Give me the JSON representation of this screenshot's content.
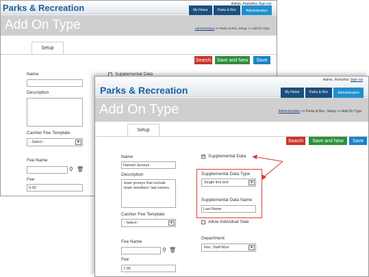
{
  "app": {
    "brand": "Parks & Recreation",
    "page_title": "Add On Type"
  },
  "topright": {
    "user": "Admin, ParksRec",
    "signout": "Sign out"
  },
  "nav": {
    "my_home": "My Home",
    "parks_rec": "Parks & Rec",
    "administration": "Administration"
  },
  "breadcrumb": {
    "admin": "Administration",
    "rest": ">> Parks & Rec. Setup >> Add On Type"
  },
  "tab": {
    "setup": "Setup"
  },
  "buttons": {
    "search": "Search",
    "save_and_new": "Save and New",
    "save": "Save"
  },
  "form": {
    "name_label": "Name",
    "name_value": "Named Jerseys",
    "description_label": "Description",
    "description_value": "team jerseys that include team members' last names.",
    "cashier_fee_template_label": "Cashier Fee Template",
    "cashier_fee_template_value": "- Select -",
    "fee_name_label": "Fee Name",
    "fee_label": "Fee",
    "fee_value_back": "0.00",
    "fee_value_front": "7.00",
    "supplemental_data_label": "Supplemental Data",
    "supplemental_data_type_label": "Supplemental Data Type",
    "supplemental_data_type_value": "Single line text",
    "supplemental_data_name_label": "Supplemental Data Name",
    "supplemental_data_name_value": "Last Name",
    "allow_individual_sale_label": "Allow Individual Sale",
    "department_label": "Department",
    "department_value": "Rec: Staff-Mun"
  },
  "icons": {
    "search": "magnifier-icon",
    "delete": "trash-icon",
    "dropdown": "chevron-down-icon",
    "check": "checkmark-icon"
  },
  "colors": {
    "brand": "#1d5f99",
    "nav": "#1b4f7d",
    "nav_active": "#1f8fcf",
    "search_btn": "#c9342a",
    "save_new_btn": "#2f8f3b",
    "save_btn": "#1b84c7",
    "callout": "#e03a3a"
  }
}
